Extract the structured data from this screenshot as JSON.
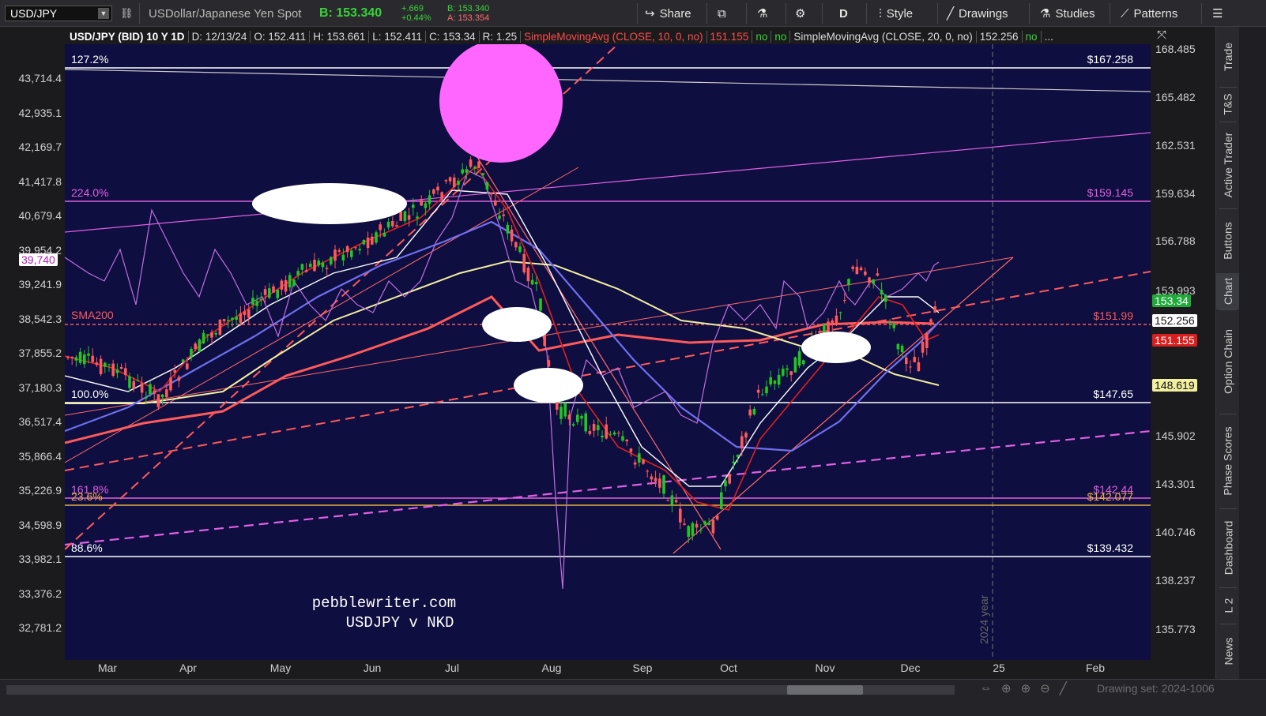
{
  "toolbar": {
    "symbol": "USD/JPY",
    "description": "USDollar/Japanese Yen Spot",
    "bid_price": "B: 153.340",
    "change_abs": "+.669",
    "change_pct": "+0.44%",
    "bid_small": "B: 153.340",
    "ask_small": "A: 153.354",
    "share_label": "Share",
    "period_label": "D",
    "style_label": "Style",
    "drawings_label": "Drawings",
    "studies_label": "Studies",
    "patterns_label": "Patterns"
  },
  "titlebar": {
    "symbol_desc": "USD/JPY (BID) 10 Y 1D",
    "date": "D: 12/13/24",
    "open": "O: 152.411",
    "high": "H: 153.661",
    "low": "L: 152.411",
    "close": "C: 153.34",
    "range": "R: 1.25",
    "sma10_label": "SimpleMovingAvg (CLOSE, 10, 0, no)",
    "sma10_value": "151.155",
    "no1": "no",
    "no2": "no",
    "sma20_label": "SimpleMovingAvg (CLOSE, 20, 0, no)",
    "sma20_value": "152.256",
    "no3": "no",
    "more": "..."
  },
  "chart": {
    "watermark_line1": "pebblewriter.com",
    "watermark_line2": "USDJPY v NKD",
    "year_marker": "2024 year",
    "sma200_label": "SMA200",
    "colors": {
      "background": "#0e0e40",
      "up_candle": "#22c622",
      "down_candle": "#ff5a5a",
      "sma10": "#e02020",
      "sma20": "#ffffff",
      "sma50": "#6f6ff0",
      "sma100": "#f3efa0",
      "sma200": "#ff5a5a",
      "nkd": "#c070e0",
      "fib_pink": "#e060e0",
      "highlight": "#ff66ff"
    },
    "fib_levels": [
      {
        "pct": "127.2%",
        "price": "$167.258",
        "color": "#ffffff"
      },
      {
        "pct": "224.0%",
        "price": "$159.145",
        "color": "#e060e0"
      },
      {
        "pct": "",
        "price": "$151.99",
        "color": "#ff5a5a"
      },
      {
        "pct": "100.0%",
        "price": "$147.65",
        "color": "#ffffff"
      },
      {
        "pct": "161.8%",
        "price": "$142.44",
        "color": "#e060e0"
      },
      {
        "pct": "23.6%",
        "price": "$142.077",
        "color": "#e8b040"
      },
      {
        "pct": "88.6%",
        "price": "$139.432",
        "color": "#ffffff"
      }
    ],
    "right_axis_ticks": [
      "168.485",
      "165.482",
      "162.531",
      "159.634",
      "156.788",
      "153.993",
      "145.902",
      "143.301",
      "140.746",
      "138.237",
      "135.773"
    ],
    "left_axis_ticks": [
      "43,714.4",
      "42,935.1",
      "42,169.7",
      "41,417.8",
      "40,679.4",
      "39,954.2",
      "39,241.9",
      "38,542.3",
      "37,855.2",
      "37,180.3",
      "36,517.4",
      "35,866.4",
      "35,226.9",
      "34,598.9",
      "33,982.1",
      "33,376.2",
      "32,781.2"
    ],
    "left_tag": "39,740",
    "price_tags": [
      {
        "value": "153.34",
        "bg": "#1faa3a",
        "fg": "#ffffff"
      },
      {
        "value": "152.256",
        "bg": "#ffffff",
        "fg": "#111111"
      },
      {
        "value": "151.155",
        "bg": "#d81e1e",
        "fg": "#ffffff"
      },
      {
        "value": "148.619",
        "bg": "#f3efa0",
        "fg": "#111111"
      }
    ],
    "x_axis_months": [
      "Mar",
      "Apr",
      "May",
      "Jun",
      "Jul",
      "Aug",
      "Sep",
      "Oct",
      "Nov",
      "Dec",
      "25",
      "Feb"
    ]
  },
  "bottom": {
    "drawing_set": "Drawing set: 2024-1006"
  },
  "sidebar": {
    "tabs": [
      "Trade",
      "T&S",
      "Active Trader",
      "Buttons",
      "Chart",
      "Option Chain",
      "Phase Scores",
      "Dashboard",
      "L 2",
      "News"
    ]
  }
}
